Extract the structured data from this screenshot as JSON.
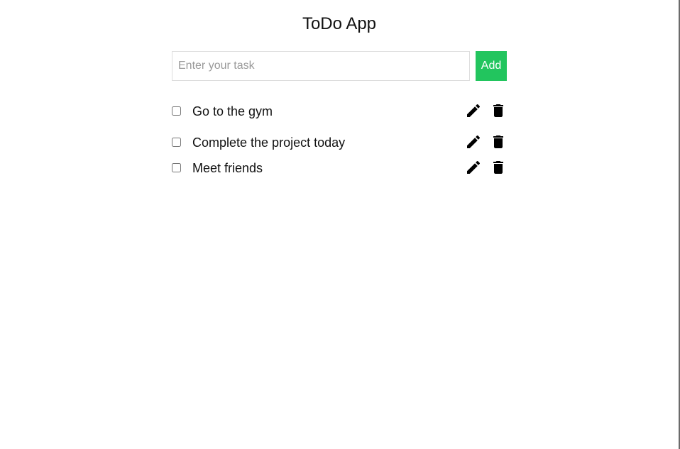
{
  "app": {
    "title": "ToDo App"
  },
  "input": {
    "placeholder": "Enter your task",
    "value": ""
  },
  "add_button": {
    "label": "Add",
    "color": "#22c55e"
  },
  "todos": [
    {
      "text": "Go to the gym",
      "completed": false,
      "actions": [
        "pencil-icon",
        "trash-icon"
      ]
    },
    {
      "text": "Complete the project today",
      "completed": false,
      "actions": [
        "pencil-icon",
        "trash-icon"
      ]
    },
    {
      "text": "Meet friends",
      "completed": false,
      "actions": [
        "pencil-icon",
        "trash-icon"
      ]
    }
  ]
}
